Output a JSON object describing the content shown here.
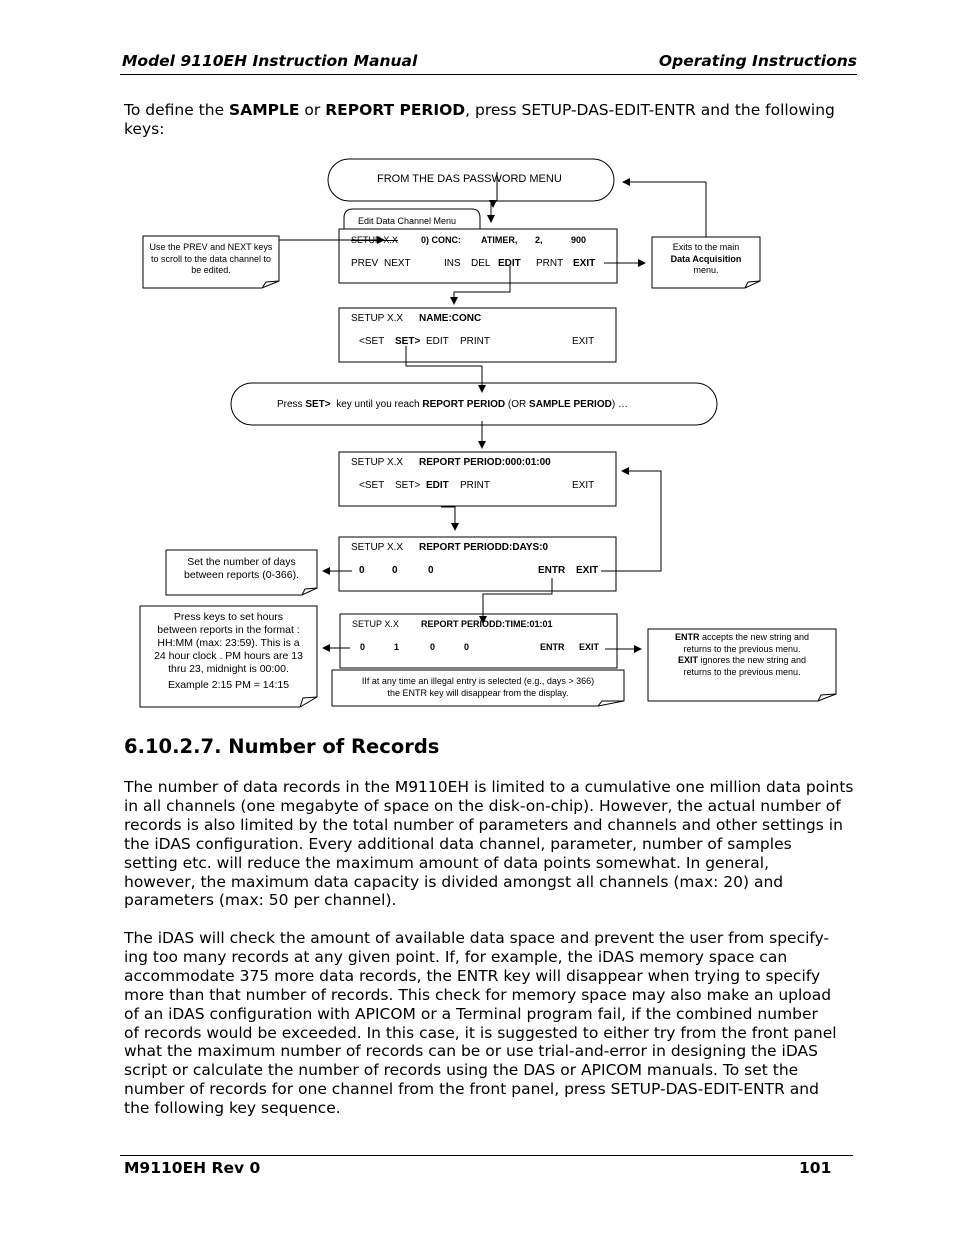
{
  "header": {
    "left": "Model 9110EH Instruction Manual",
    "right": "Operating Instructions"
  },
  "intro": {
    "pre": "To define the ",
    "sample": "SAMPLE",
    "or": " or ",
    "report_period": "REPORT PERIOD",
    "post": ", press SETUP-DAS-EDIT-ENTR and the following keys:"
  },
  "diagram": {
    "start_oval": "FROM THE DAS PASSWORD MENU",
    "tab_label": "Edit Data Channel Menu",
    "screen1": {
      "setup": "SETUP X.X",
      "line1": [
        "0) CONC:",
        "ATIMER,",
        "2,",
        "900"
      ],
      "keys": [
        "PREV",
        "NEXT",
        "INS",
        "DEL",
        "EDIT",
        "PRNT",
        "EXIT"
      ]
    },
    "note_prev_next": "Use the PREV and NEXT keys to scroll to the data channel to be edited.",
    "note_exit": {
      "line1": "Exits to the main",
      "bold": "Data Acquisition",
      "line3": "menu."
    },
    "screen2": {
      "setup": "SETUP X.X",
      "title": "NAME:CONC",
      "keys": [
        "<SET",
        "SET>",
        "EDIT",
        "PRINT",
        "EXIT"
      ]
    },
    "press_oval": {
      "t1": "Press ",
      "b1": "SET>",
      "t2": "  key until you reach ",
      "b2": "REPORT PERIOD",
      "t3": " (OR ",
      "b3": "SAMPLE PERIOD",
      "t4": ") …"
    },
    "screen3": {
      "setup": "SETUP X.X",
      "title": "REPORT PERIOD:000:01:00",
      "keys": [
        "<SET",
        "SET>",
        "EDIT",
        "PRINT",
        "EXIT"
      ]
    },
    "screen4": {
      "setup": "SETUP X.X",
      "title": "REPORT PERIODD:DAYS:0",
      "keys": [
        "0",
        "0",
        "0",
        "ENTR",
        "EXIT"
      ]
    },
    "note_days": "Set  the number of days between reports (0-366).",
    "screen5": {
      "setup": "SETUP X.X",
      "title": "REPORT PERIODD:TIME:01:01",
      "keys": [
        "0",
        "1",
        "0",
        "0",
        "ENTR",
        "EXIT"
      ]
    },
    "note_hours": [
      "Press keys to set hours",
      "between reports in the format :",
      "HH:MM (max: 23:59). This is a",
      "24 hour clock . PM hours are 13",
      "thru 23, midnight is 00:00.",
      "Example 2:15 PM = 14:15"
    ],
    "note_illegal": [
      "IIf at any time an illegal entry is selected (e.g., days > 366)",
      "the ENTR key will disappear from the display."
    ],
    "note_entr_exit": {
      "b1": "ENTR",
      "t1": " accepts the new string and",
      "t2": "returns to the previous menu.",
      "b2": "EXIT",
      "t3": " ignores the new string and",
      "t4": "returns to the previous menu."
    }
  },
  "section": {
    "heading": "6.10.2.7. Number of Records",
    "para1": [
      "The number of data records in the M9110EH is limited to a cumulative one million data points",
      "in all channels (one megabyte of space on the disk-on-chip). However, the actual number of",
      "records is also limited by the total number of parameters and channels and other settings in",
      "the iDAS configuration. Every additional data channel, parameter, number of samples",
      "setting etc. will reduce the maximum amount of data points somewhat. In general,",
      "however, the maximum data capacity is divided amongst all channels (max: 20) and",
      "parameters (max: 50 per channel)."
    ],
    "para2": [
      "The iDAS will check the amount of available data space and prevent the user from specify-",
      "ing too many records at any given point. If, for example, the iDAS memory space can",
      "accommodate 375 more data records, the ENTR key will disappear when trying to specify",
      "more than that number of records. This check for memory space may also make an upload",
      "of an iDAS configuration with APICOM or a Terminal program fail, if the combined number",
      "of records would be exceeded. In this case, it is suggested to either try from the front panel",
      "what the maximum number of records can be or use trial-and-error in designing the iDAS",
      "script or calculate the number of records using the DAS or APICOM manuals. To set the",
      "number of records for one channel from the front panel, press SETUP-DAS-EDIT-ENTR and",
      "the following key sequence."
    ]
  },
  "footer": {
    "left": "M9110EH Rev 0",
    "right": "101"
  }
}
